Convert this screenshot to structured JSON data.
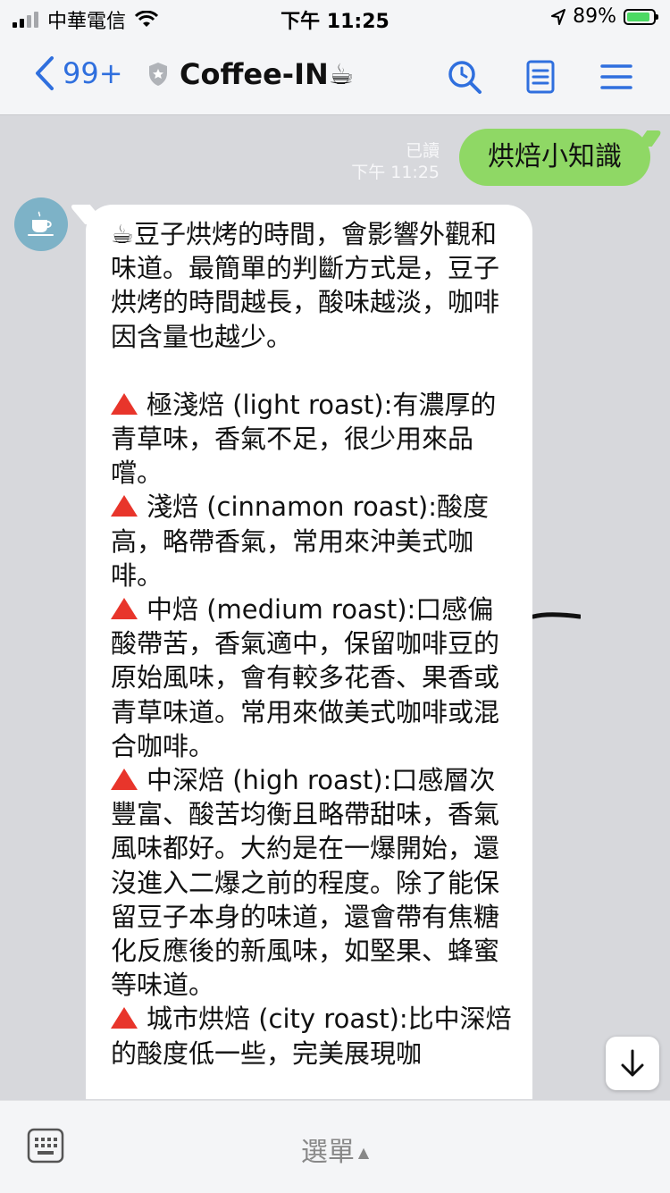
{
  "status_bar": {
    "carrier": "中華電信",
    "time": "下午 11:25",
    "battery": "89%",
    "battery_level": 0.89
  },
  "nav": {
    "back_count": "99+",
    "title": "Coffee-IN☕"
  },
  "sent": {
    "read_label": "已讀",
    "time": "下午 11:25",
    "text": "烘焙小知識"
  },
  "received": {
    "intro": "☕豆子烘烤的時間，會影響外觀和味道。最簡單的判斷方式是，豆子烘烤的時間越長，酸味越淡，咖啡因含量也越少。",
    "items": [
      {
        "text": "極淺焙 (light roast):有濃厚的青草味，香氣不足，很少用來品嚐。"
      },
      {
        "text": "淺焙 (cinnamon roast):酸度高，略帶香氣，常用來沖美式咖啡。"
      },
      {
        "text": "中焙 (medium roast):口感偏酸帶苦，香氣適中，保留咖啡豆的原始風味，會有較多花香、果香或青草味道。常用來做美式咖啡或混合咖啡。"
      },
      {
        "text": "中深焙 (high roast):口感層次豐富、酸苦均衡且略帶甜味，香氣風味都好。大約是在一爆開始，還沒進入二爆之前的程度。除了能保留豆子本身的味道，還會帶有焦糖化反應後的新風味，如堅果、蜂蜜等味道。"
      },
      {
        "text": "城市烘焙 (city roast):比中深焙的酸度低一些，完美展現咖"
      }
    ]
  },
  "bottom_bar": {
    "menu_label": "選單"
  },
  "colors": {
    "accent_blue": "#2f6fde",
    "sent_bubble": "#8fd865",
    "chat_bg": "#d7d8dc",
    "warning_triangle": "#e8352b"
  }
}
